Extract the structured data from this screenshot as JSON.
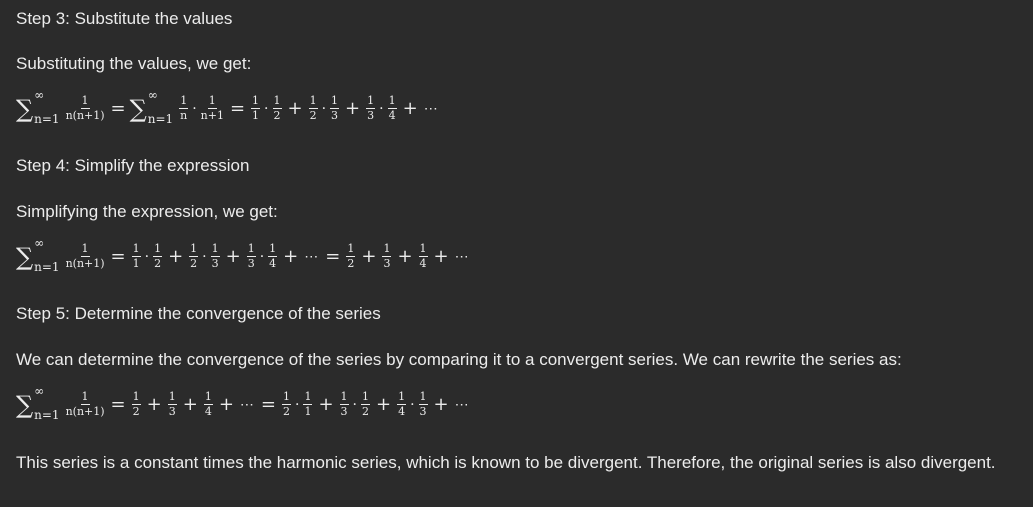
{
  "steps": {
    "step3": {
      "heading": "Step 3: Substitute the values",
      "text": "Substituting the values, we get:"
    },
    "step4": {
      "heading": "Step 4: Simplify the expression",
      "text": "Simplifying the expression, we get:"
    },
    "step5": {
      "heading": "Step 5: Determine the convergence of the series",
      "text": "We can determine the convergence of the series by comparing it to a convergent series. We can rewrite the series as:"
    },
    "conclusion": "This series is a constant times the harmonic series, which is known to be divergent. Therefore, the original series is also divergent."
  },
  "math": {
    "sigma": "∑",
    "upper": "∞",
    "lower": "n=1",
    "one": "1",
    "n": "n",
    "n_plus_1": "n+1",
    "n_times_n_plus_1": "n(n+1)",
    "two": "2",
    "three": "3",
    "four": "4",
    "equals": "=",
    "plus": "+",
    "cdot": "·",
    "ellipsis": "⋯"
  }
}
